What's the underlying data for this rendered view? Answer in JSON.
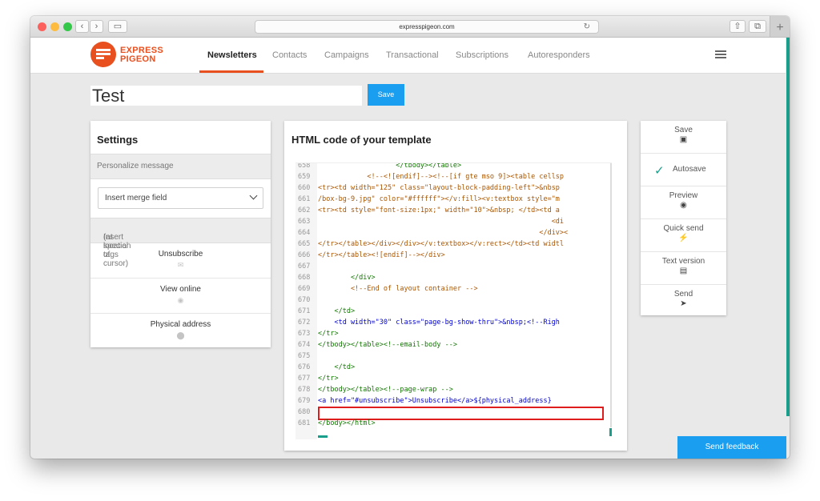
{
  "browser": {
    "url": "expresspigeon.com",
    "back_glyph": "‹",
    "forward_glyph": "›",
    "sidebar_glyph": "▭",
    "share_glyph": "⇧",
    "tabs_glyph": "⧉",
    "new_tab_glyph": "+",
    "reload_glyph": "↻"
  },
  "header": {
    "logo_line1": "EXPRESS",
    "logo_line2": "PIGEON",
    "nav": [
      "Newsletters",
      "Contacts",
      "Campaigns",
      "Transactional",
      "Subscriptions",
      "Autoresponders"
    ],
    "active_nav": "Newsletters"
  },
  "editor": {
    "title_value": "Test",
    "save_label": "Save"
  },
  "settings": {
    "title": "Settings",
    "personalize_label": "Personalize message",
    "merge_field_placeholder": "Insert merge field",
    "special_tags_label": "Insert special tags",
    "special_tags_note": "(at location of cursor)",
    "tags": [
      {
        "label": "Unsubscribe",
        "icon": "envelope-icon",
        "glyph": "✉"
      },
      {
        "label": "View online",
        "icon": "globe-icon",
        "glyph": "◉"
      },
      {
        "label": "Physical address",
        "icon": "map-pin-icon",
        "glyph": "⬤"
      }
    ]
  },
  "code_panel": {
    "title": "HTML code of your template",
    "lines": [
      {
        "n": "658",
        "code": "                   </tbody></table>",
        "color": "green"
      },
      {
        "n": "659",
        "code": "            <!--<![endif]--><!--[if gte mso 9]><table cellsp",
        "color": "orange"
      },
      {
        "n": "660",
        "code": "<tr><td width=\"125\" class=\"layout-block-padding-left\">&nbsp",
        "color": "orange"
      },
      {
        "n": "661",
        "code": "/box-bg-9.jpg\" color=\"#ffffff\"></v:fill><v:textbox style=\"m",
        "color": "orange"
      },
      {
        "n": "662",
        "code": "<tr><td style=\"font-size:1px;\" width=\"10\">&nbsp; </td><td a",
        "color": "orange"
      },
      {
        "n": "663",
        "code": "                                                         <di",
        "color": "orange"
      },
      {
        "n": "664",
        "code": "                                                      </div><",
        "color": "orange"
      },
      {
        "n": "665",
        "code": "</tr></table></div></div></v:textbox></v:rect></td><td widtl",
        "color": "orange"
      },
      {
        "n": "666",
        "code": "</tr></table><![endif]--></div>",
        "color": "orange"
      },
      {
        "n": "667",
        "code": "",
        "color": "black"
      },
      {
        "n": "668",
        "code": "        </div>",
        "color": "green"
      },
      {
        "n": "669",
        "code": "        <!--End of layout container -->",
        "color": "orange"
      },
      {
        "n": "670",
        "code": "",
        "color": "black"
      },
      {
        "n": "671",
        "code": "    </td>",
        "color": "green"
      },
      {
        "n": "672",
        "code": "    <td width=\"30\" class=\"page-bg-show-thru\">&nbsp;<!--Righ",
        "color": "mixed672"
      },
      {
        "n": "673",
        "code": "</tr>",
        "color": "green"
      },
      {
        "n": "674",
        "code": "</tbody></table><!--email-body -->",
        "color": "mixed674"
      },
      {
        "n": "675",
        "code": "",
        "color": "black"
      },
      {
        "n": "676",
        "code": "    </td>",
        "color": "green"
      },
      {
        "n": "677",
        "code": "</tr>",
        "color": "green"
      },
      {
        "n": "678",
        "code": "</tbody></table><!--page-wrap -->",
        "color": "mixed674"
      },
      {
        "n": "679",
        "code": "<a href=\"#unsubscribe\">Unsubscribe</a>${physical_address}",
        "color": "mixed679"
      },
      {
        "n": "680",
        "code": "",
        "color": "black"
      },
      {
        "n": "681",
        "code": "</body></html>",
        "color": "green"
      }
    ]
  },
  "actions": [
    {
      "label": "Save",
      "icon": "floppy-icon",
      "glyph": "▣"
    },
    {
      "label": "Autosave",
      "icon": "checkmark-icon",
      "glyph": "✓"
    },
    {
      "label": "Preview",
      "icon": "eye-icon",
      "glyph": "◉"
    },
    {
      "label": "Quick send",
      "icon": "bolt-icon",
      "glyph": "⚡"
    },
    {
      "label": "Text version",
      "icon": "document-icon",
      "glyph": "▤"
    },
    {
      "label": "Send",
      "icon": "paper-plane-icon",
      "glyph": "➤"
    }
  ],
  "feedback_label": "Send feedback",
  "colors": {
    "accent": "#1a9ef0",
    "brand": "#e8501f",
    "teal": "#1a9e8c"
  }
}
